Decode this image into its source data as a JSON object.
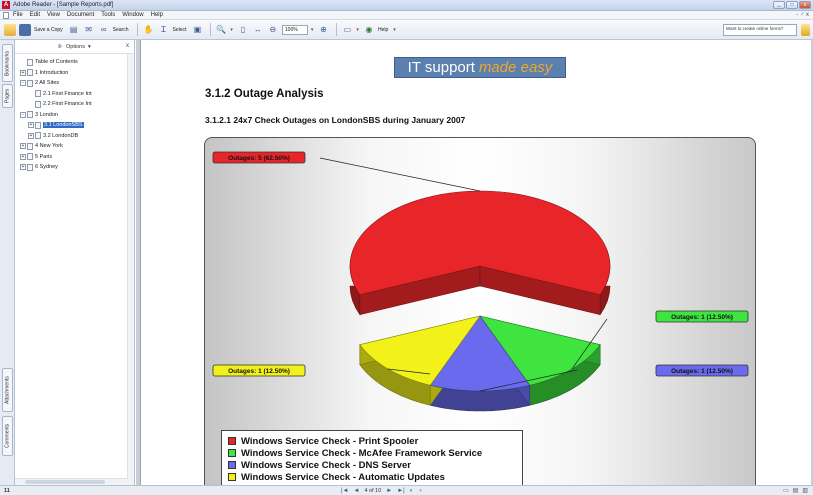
{
  "window": {
    "title": "Adobe Reader - [Sample Reports.pdf]",
    "controls": [
      "_",
      "□",
      "x"
    ]
  },
  "menu": {
    "items": [
      "File",
      "Edit",
      "View",
      "Document",
      "Tools",
      "Window",
      "Help"
    ],
    "right": "- ♂ x"
  },
  "toolbar": {
    "save_copy": "Save a Copy",
    "search": "Search",
    "select": "Select",
    "zoom": "100%",
    "help": "Help",
    "help_box": "Want to create online forms?"
  },
  "side_tabs": {
    "bookmarks": "Bookmarks",
    "pages": "Pages",
    "attachments": "Attachments",
    "comments": "Comments"
  },
  "bookmarks": {
    "options_label": "Options",
    "close": "x",
    "items": [
      {
        "label": "Table of Contents",
        "toggle": "",
        "selected": false
      },
      {
        "label": "1 Introduction",
        "toggle": "+",
        "selected": false
      },
      {
        "label": "2 All Sites",
        "toggle": "-",
        "selected": false
      },
      {
        "label": "2.1 First Finance Int",
        "toggle": "",
        "selected": false
      },
      {
        "label": "2.2 First Finance Int",
        "toggle": "",
        "selected": false
      },
      {
        "label": "3 London",
        "toggle": "-",
        "selected": false
      },
      {
        "label": "3.1 LondonSBS",
        "toggle": "+",
        "selected": true
      },
      {
        "label": "3.2 LondonDB",
        "toggle": "+",
        "selected": false
      },
      {
        "label": "4 New York",
        "toggle": "+",
        "selected": false
      },
      {
        "label": "5 Paris",
        "toggle": "+",
        "selected": false
      },
      {
        "label": "6 Sydney",
        "toggle": "+",
        "selected": false
      }
    ]
  },
  "document": {
    "banner_main": "IT support",
    "banner_accent": "made easy",
    "heading": "3.1.2 Outage Analysis",
    "subheading": "3.1.2.1 24x7 Check Outages on LondonSBS during January 2007"
  },
  "chart_data": {
    "type": "pie",
    "title": "",
    "series": [
      {
        "name": "Windows Service Check - Print Spooler",
        "value": 5,
        "percent": 62.5,
        "label": "Outages: 5 (62.50%)",
        "color": "#e8262a"
      },
      {
        "name": "Windows Service Check - McAfee Framework Service",
        "value": 1,
        "percent": 12.5,
        "label": "Outages: 1 (12.50%)",
        "color": "#3fe43f"
      },
      {
        "name": "Windows Service Check - DNS Server",
        "value": 1,
        "percent": 12.5,
        "label": "Outages: 1 (12.50%)",
        "color": "#6a6aee"
      },
      {
        "name": "Windows Service Check - Automatic Updates",
        "value": 1,
        "percent": 12.5,
        "label": "Outages: 1 (12.50%)",
        "color": "#f2f21a"
      }
    ],
    "exploded": "Windows Service Check - Print Spooler",
    "legend_position": "bottom-left"
  },
  "status": {
    "left": "11",
    "page_field": "4 of 10",
    "nav": [
      "|◄",
      "◄",
      "►",
      "►|"
    ]
  }
}
